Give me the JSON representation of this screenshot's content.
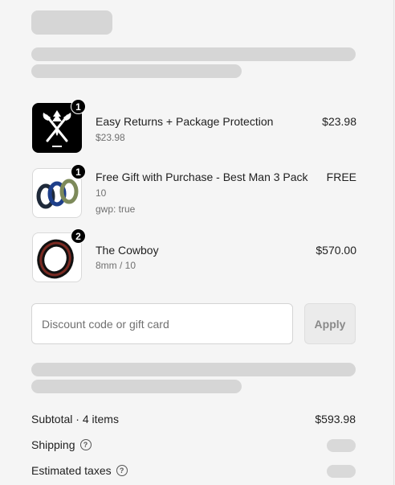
{
  "order_summary": {
    "line_items": [
      {
        "quantity": "1",
        "name": "Easy Returns + Package Protection",
        "details": [
          "$23.98"
        ],
        "price": "$23.98",
        "image_icon": "axes-shield-logo-icon"
      },
      {
        "quantity": "1",
        "name": "Free Gift with Purchase - Best Man 3 Pack",
        "details": [
          "10",
          "gwp: true"
        ],
        "price": "FREE",
        "image_icon": "silicone-rings-icon"
      },
      {
        "quantity": "2",
        "name": "The Cowboy",
        "details": [
          "8mm / 10"
        ],
        "price": "$570.00",
        "image_icon": "black-ring-icon"
      }
    ],
    "discount": {
      "placeholder": "Discount code or gift card",
      "value": "",
      "apply_label": "Apply"
    },
    "totals": {
      "subtotal_label": "Subtotal · 4 items",
      "subtotal_value": "$593.98",
      "shipping_label": "Shipping",
      "taxes_label": "Estimated taxes"
    }
  },
  "colors": {
    "background": "#f5f5f5",
    "skeleton": "#d6d6d6",
    "badge": "#000000"
  }
}
